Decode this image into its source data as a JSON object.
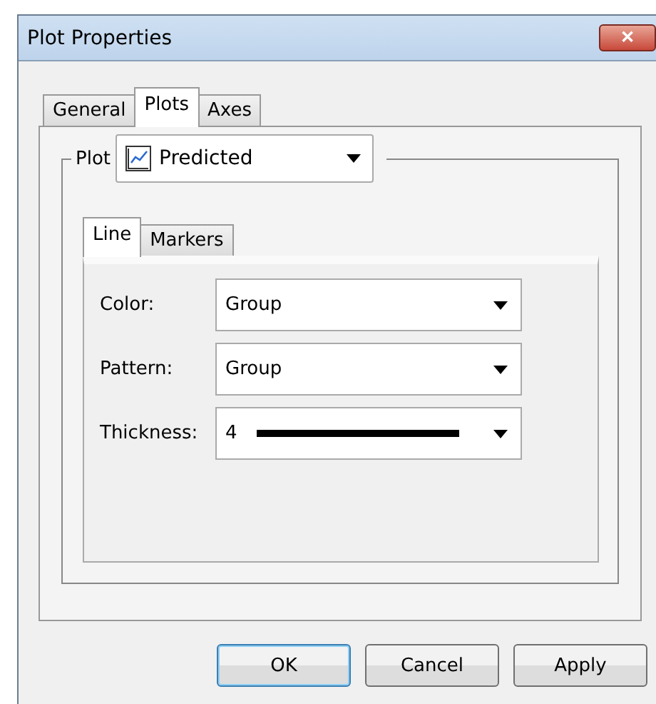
{
  "window": {
    "title": "Plot Properties",
    "close": "✕"
  },
  "tabs": [
    {
      "label": "General",
      "selected": false
    },
    {
      "label": "Plots",
      "selected": true
    },
    {
      "label": "Axes",
      "selected": false
    }
  ],
  "plot": {
    "label": "Plot",
    "value": "Predicted"
  },
  "subtabs": [
    {
      "label": "Line",
      "selected": true
    },
    {
      "label": "Markers",
      "selected": false
    }
  ],
  "fields": [
    {
      "kind": "text",
      "label": "Color:",
      "value": "Group"
    },
    {
      "kind": "text",
      "label": "Pattern:",
      "value": "Group"
    },
    {
      "kind": "thickness",
      "label": "Thickness:",
      "value": "4"
    }
  ],
  "buttons": [
    {
      "label": "OK",
      "default": true
    },
    {
      "label": "Cancel",
      "default": false
    },
    {
      "label": "Apply",
      "default": false
    }
  ]
}
